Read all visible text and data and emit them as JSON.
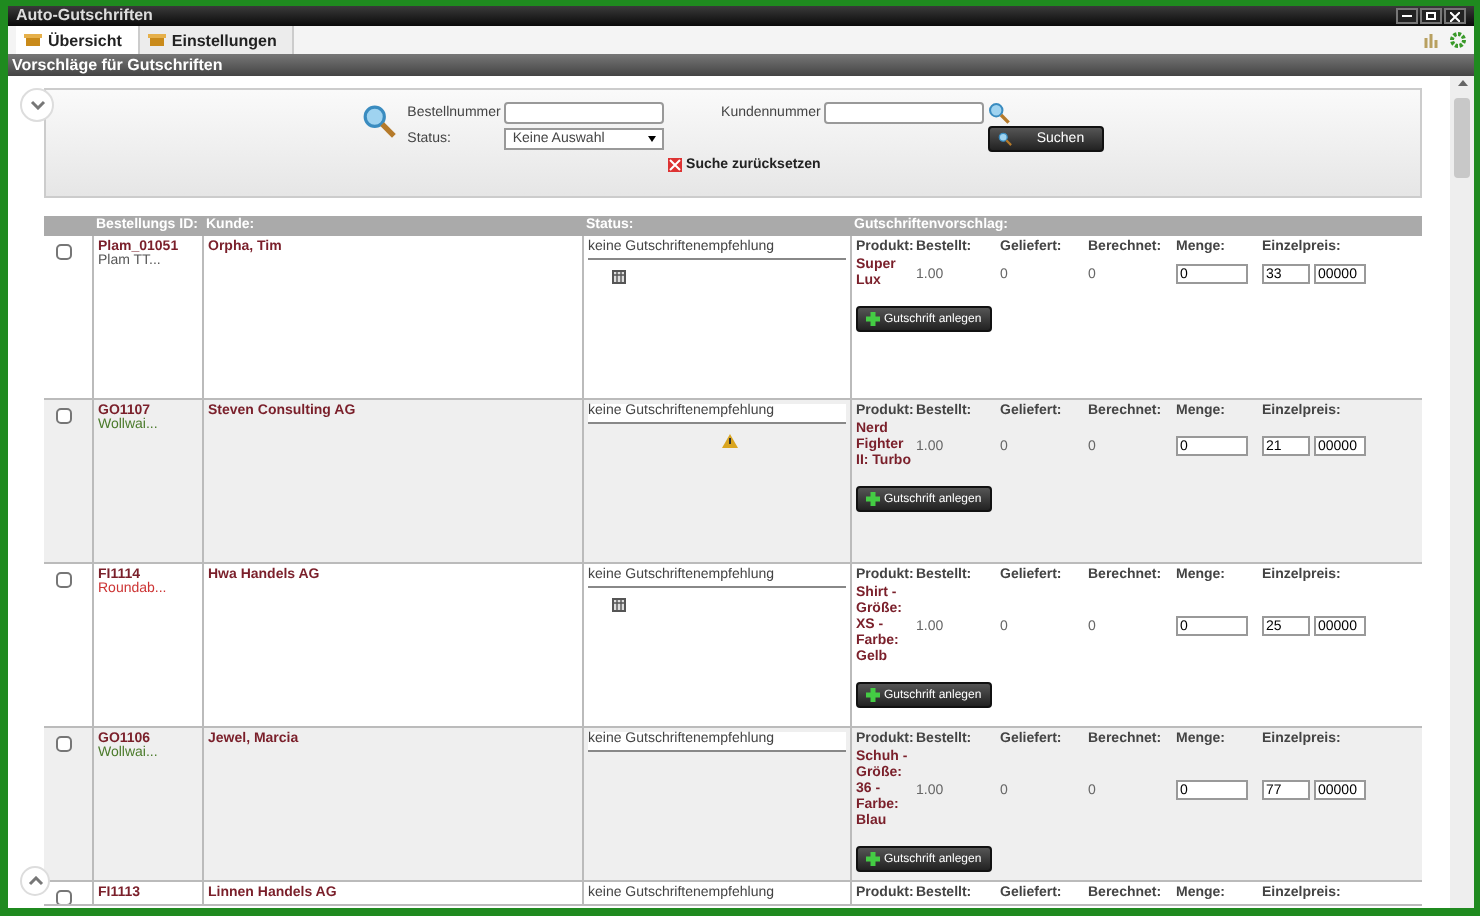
{
  "window": {
    "title": "Auto-Gutschriften"
  },
  "tabs": [
    {
      "label": "Übersicht",
      "selected": true
    },
    {
      "label": "Einstellungen",
      "selected": false
    }
  ],
  "section_title": "Vorschläge für Gutschriften",
  "filter": {
    "order_label": "Bestellnummer",
    "customer_label": "Kundennummer",
    "status_label": "Status:",
    "status_value": "Keine Auswahl",
    "search_button": "Suchen",
    "reset_link": "Suche zurücksetzen"
  },
  "table": {
    "columns": [
      "Bestellungs ID:",
      "Kunde:",
      "Status:",
      "Gutschriftenvorschlag:"
    ],
    "rows": [
      {
        "checked": false,
        "id": "Plam_01051",
        "sub": "Plam TT...",
        "color": "#555555",
        "customer": "Orpha, Tim",
        "status": "keine Gutschriftenempfehlung",
        "kind": "calendar",
        "product_columns": [
          "Produkt:",
          "Bestellt:",
          "Geliefert:",
          "Berechnet:",
          "Menge:",
          "Einzelpreis:"
        ],
        "product": "Super Lux",
        "ordered": "1.00",
        "delivered": "0",
        "billed": "0",
        "quantity": "0",
        "price": "33",
        "decimals": "00000",
        "button": "Gutschrift anlegen"
      },
      {
        "checked": false,
        "id": "GO1107",
        "sub": "Wollwai...",
        "color": "#4a7a2a",
        "customer": "Steven Consulting AG",
        "status": "keine Gutschriftenempfehlung",
        "kind": "warning",
        "product_columns": [
          "Produkt:",
          "Bestellt:",
          "Geliefert:",
          "Berechnet:",
          "Menge:",
          "Einzelpreis:"
        ],
        "product": "Nerd Fighter II: Turbo",
        "ordered": "1.00",
        "delivered": "0",
        "billed": "0",
        "quantity": "0",
        "price": "21",
        "decimals": "00000",
        "button": "Gutschrift anlegen"
      },
      {
        "checked": false,
        "id": "FI1114",
        "sub": "Roundab...",
        "color": "#cc3333",
        "customer": "Hwa Handels AG",
        "status": "keine Gutschriftenempfehlung",
        "kind": "calendar",
        "product_columns": [
          "Produkt:",
          "Bestellt:",
          "Geliefert:",
          "Berechnet:",
          "Menge:",
          "Einzelpreis:"
        ],
        "product": "Shirt - Größe: XS - Farbe: Gelb",
        "ordered": "1.00",
        "delivered": "0",
        "billed": "0",
        "quantity": "0",
        "price": "25",
        "decimals": "00000",
        "button": "Gutschrift anlegen"
      },
      {
        "checked": false,
        "id": "GO1106",
        "sub": "Wollwai...",
        "color": "#4a7a2a",
        "customer": "Jewel, Marcia",
        "status": "keine Gutschriftenempfehlung",
        "kind": "plain",
        "product_columns": [
          "Produkt:",
          "Bestellt:",
          "Geliefert:",
          "Berechnet:",
          "Menge:",
          "Einzelpreis:"
        ],
        "product": "Schuh - Größe: 36 - Farbe: Blau",
        "ordered": "1.00",
        "delivered": "0",
        "billed": "0",
        "quantity": "0",
        "price": "77",
        "decimals": "00000",
        "button": "Gutschrift anlegen"
      }
    ],
    "partial_row": {
      "checked": false,
      "id": "FI1113",
      "customer": "Linnen Handels AG",
      "status": "keine Gutschriftenempfehlung",
      "product_columns": [
        "Produkt:",
        "Bestellt:",
        "Geliefert:",
        "Berechnet:",
        "Menge:",
        "Einzelpreis:"
      ]
    }
  }
}
